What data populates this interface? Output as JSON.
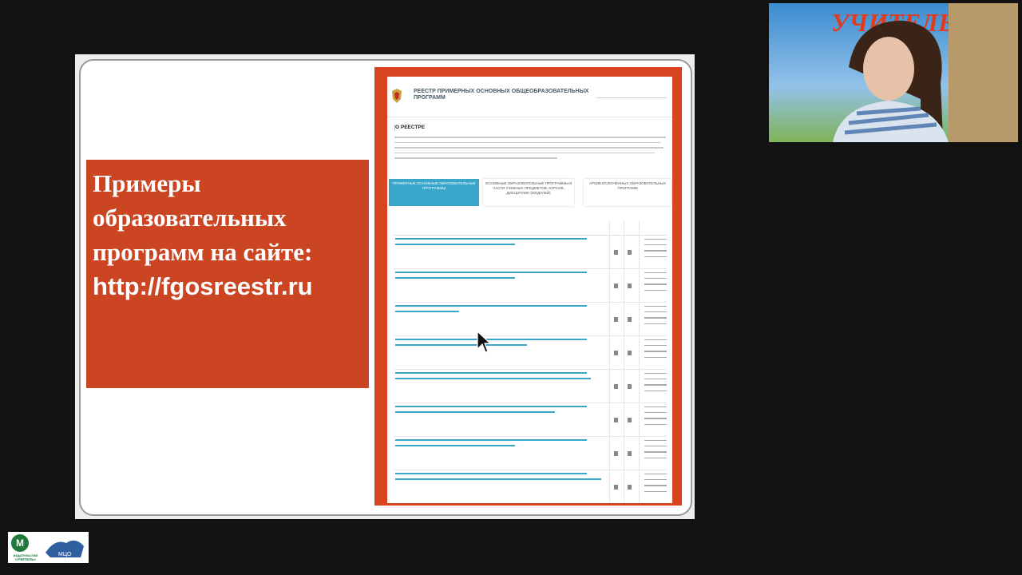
{
  "slide": {
    "title": "Примеры образовательных программ на сайте:",
    "url": "http://fgosreestr.ru"
  },
  "site": {
    "header_title": "РЕЕСТР ПРИМЕРНЫХ ОСНОВНЫХ ОБЩЕОБРАЗОВАТЕЛЬНЫХ ПРОГРАММ",
    "about_heading": "О РЕЕСТРЕ",
    "tabs": [
      "ПРИМЕРНЫЕ ОСНОВНЫЕ ОБРАЗОВАТЕЛЬНЫЕ ПРОГРАММЫ",
      "ОСНОВНЫЕ ОБРАЗОВАТЕЛЬНЫЕ ПРОГРАММЫ В ЧАСТИ УЧЕБНЫХ ПРЕДМЕТОВ, КУРСОВ, ДИСЦИПЛИН (МОДУЛЕЙ)",
      "АРХИВ ИСЛЮЧЕННЫХ ОБРАЗОВАТЕЛЬНЫХ ПРОГРАММ"
    ]
  },
  "webcam": {
    "sign": "УЧИТЕЛЬ"
  },
  "logo": {
    "text": "издательство «УЧИТЕЛЬ»",
    "badge": "М",
    "right_text": "МЦО"
  },
  "colors": {
    "slide_accent": "#cc4522",
    "site_accent": "#3aa6c9",
    "frame": "#d8441f"
  }
}
